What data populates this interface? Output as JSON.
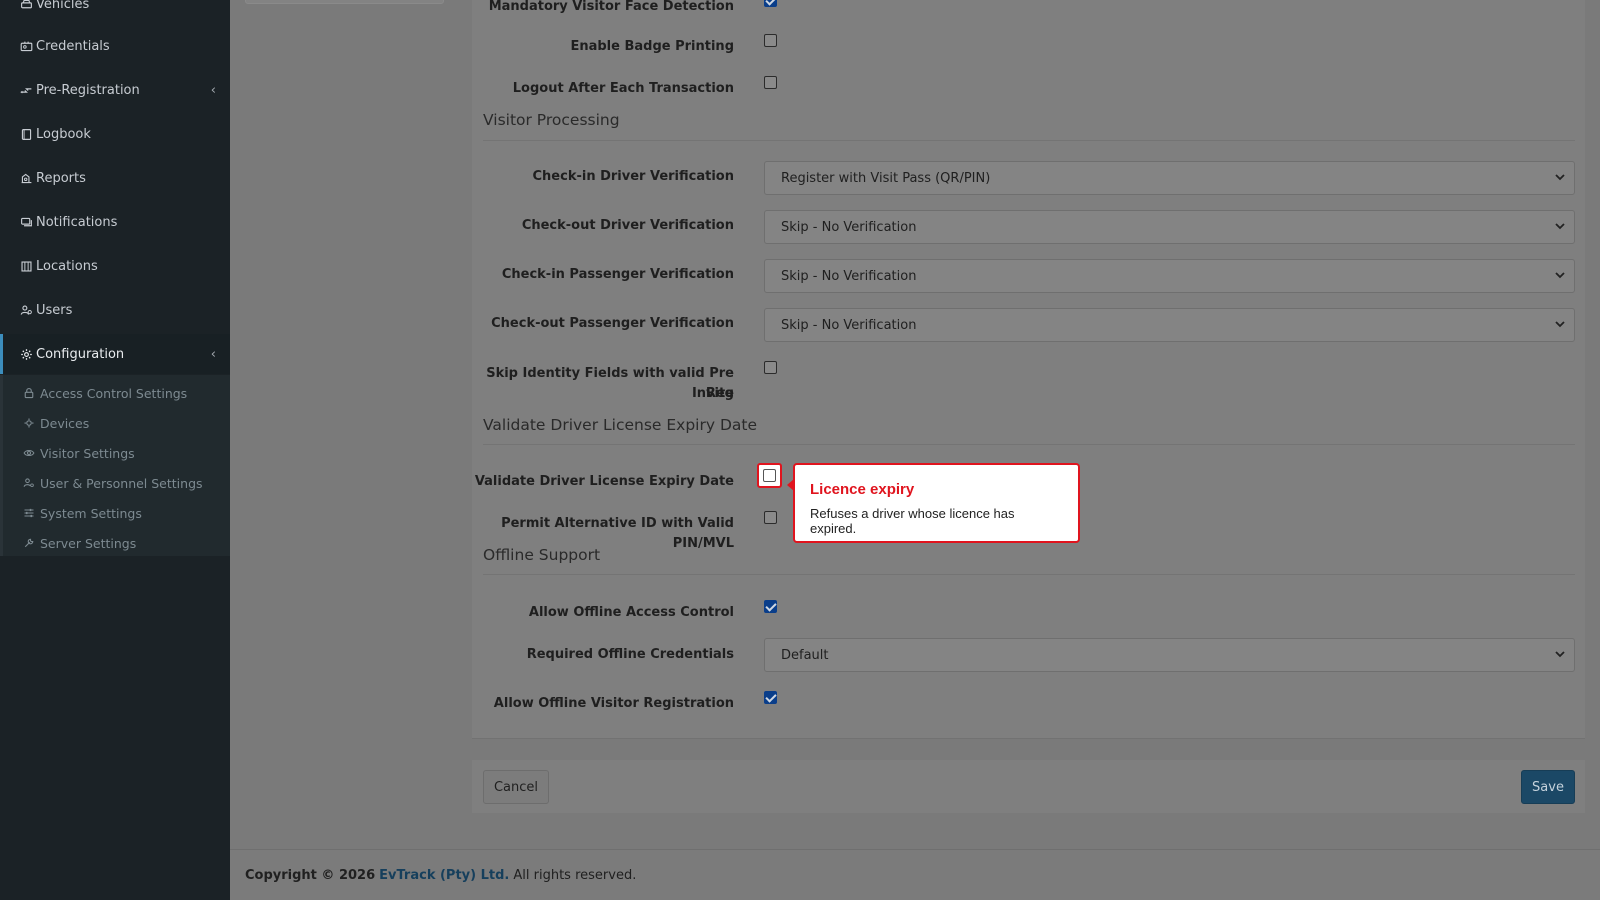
{
  "sidebar": {
    "items": [
      {
        "label": "Vehicles",
        "icon": "car-icon"
      },
      {
        "label": "Credentials",
        "icon": "id-card-icon"
      },
      {
        "label": "Pre-Registration",
        "icon": "exchange-icon"
      },
      {
        "label": "Logbook",
        "icon": "book-icon"
      },
      {
        "label": "Reports",
        "icon": "chart-icon"
      },
      {
        "label": "Notifications",
        "icon": "message-icon"
      },
      {
        "label": "Locations",
        "icon": "building-icon"
      },
      {
        "label": "Users",
        "icon": "users-icon"
      },
      {
        "label": "Configuration",
        "icon": "gear-icon"
      }
    ],
    "submenu": [
      {
        "label": "Access Control Settings",
        "icon": "lock-icon"
      },
      {
        "label": "Devices",
        "icon": "device-icon"
      },
      {
        "label": "Visitor Settings",
        "icon": "eye-icon"
      },
      {
        "label": "User & Personnel Settings",
        "icon": "user-cog-icon"
      },
      {
        "label": "System Settings",
        "icon": "sliders-icon"
      },
      {
        "label": "Server Settings",
        "icon": "tools-icon"
      }
    ]
  },
  "form": {
    "mandatory_face_label": "Mandatory Visitor Face Detection",
    "mandatory_face_checked": true,
    "badge_printing_label": "Enable Badge Printing",
    "badge_printing_checked": false,
    "logout_label": "Logout After Each Transaction",
    "logout_checked": false,
    "section_visitor_processing": "Visitor Processing",
    "checkin_driver_label": "Check-in Driver Verification",
    "checkin_driver_value": "Register with Visit Pass (QR/PIN)",
    "checkout_driver_label": "Check-out Driver Verification",
    "checkout_driver_value": "Skip - No Verification",
    "checkin_passenger_label": "Check-in Passenger Verification",
    "checkin_passenger_value": "Skip - No Verification",
    "checkout_passenger_label": "Check-out Passenger Verification",
    "checkout_passenger_value": "Skip - No Verification",
    "skip_identity_label_1": "Skip Identity Fields with valid Pre Reg",
    "skip_identity_label_2": "Invite",
    "skip_identity_checked": false,
    "section_validate_license": "Validate Driver License Expiry Date",
    "validate_license_label": "Validate Driver License Expiry Date",
    "validate_license_checked": false,
    "permit_alt_id_label": "Permit Alternative ID with Valid PIN/MVL",
    "permit_alt_id_checked": false,
    "section_offline": "Offline Support",
    "allow_offline_access_label": "Allow Offline Access Control",
    "allow_offline_access_checked": true,
    "required_offline_cred_label": "Required Offline Credentials",
    "required_offline_cred_value": "Default",
    "allow_offline_visitor_label": "Allow Offline Visitor Registration",
    "allow_offline_visitor_checked": true
  },
  "actions": {
    "cancel_label": "Cancel",
    "save_label": "Save"
  },
  "tooltip": {
    "title": "Licence expiry",
    "body": "Refuses a driver whose licence has expired."
  },
  "footer": {
    "copyright": "Copyright © 2026",
    "company": "EvTrack (Pty) Ltd.",
    "rights": "All rights reserved."
  },
  "colors": {
    "accent": "#3c8dbc",
    "highlight": "#e0141e",
    "sidebar_bg": "#1b2226"
  }
}
